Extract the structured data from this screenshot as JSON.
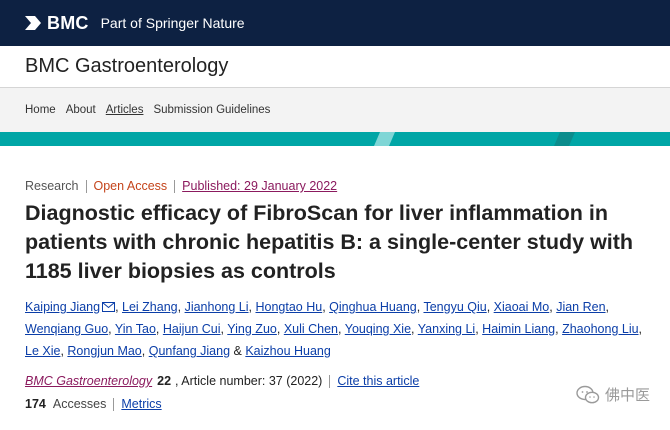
{
  "header": {
    "brand": "BMC",
    "tagline": "Part of Springer Nature"
  },
  "journal": {
    "title": "BMC Gastroenterology"
  },
  "nav": {
    "items": [
      {
        "label": "Home"
      },
      {
        "label": "About"
      },
      {
        "label": "Articles",
        "active": true
      },
      {
        "label": "Submission Guidelines"
      }
    ]
  },
  "colors": {
    "navy": "#0d2142",
    "accent_teal": "#00a6a6",
    "open_access": "#c4441b",
    "link_blue": "#0b3ea8",
    "link_purple": "#8b1a5e"
  },
  "article": {
    "type": "Research",
    "access": "Open Access",
    "published": "Published: 29 January 2022",
    "title": "Diagnostic efficacy of FibroScan for liver inflammation in patients with chronic hepatitis B: a single-center study with 1185 liver biopsies as controls",
    "authors": [
      "Kaiping Jiang",
      "Lei Zhang",
      "Jianhong Li",
      "Hongtao Hu",
      "Qinghua Huang",
      "Tengyu Qiu",
      "Xiaoai Mo",
      "Jian Ren",
      "Wenqiang Guo",
      "Yin Tao",
      "Haijun Cui",
      "Ying Zuo",
      "Xuli Chen",
      "Youqing Xie",
      "Yanxing Li",
      "Haimin Liang",
      "Zhaohong Liu",
      "Le Xie",
      "Rongjun Mao",
      "Qunfang Jiang",
      "Kaizhou Huang"
    ],
    "authors_conjunction": "&",
    "journal_ref": "BMC Gastroenterology",
    "volume": "22",
    "article_number": ", Article number: 37 (2022)",
    "cite_label": "Cite this article",
    "accesses_count": "174",
    "accesses_label": "Accesses",
    "metrics_label": "Metrics"
  },
  "watermark": {
    "text": "佛中医",
    "icon": "wechat-icon"
  }
}
